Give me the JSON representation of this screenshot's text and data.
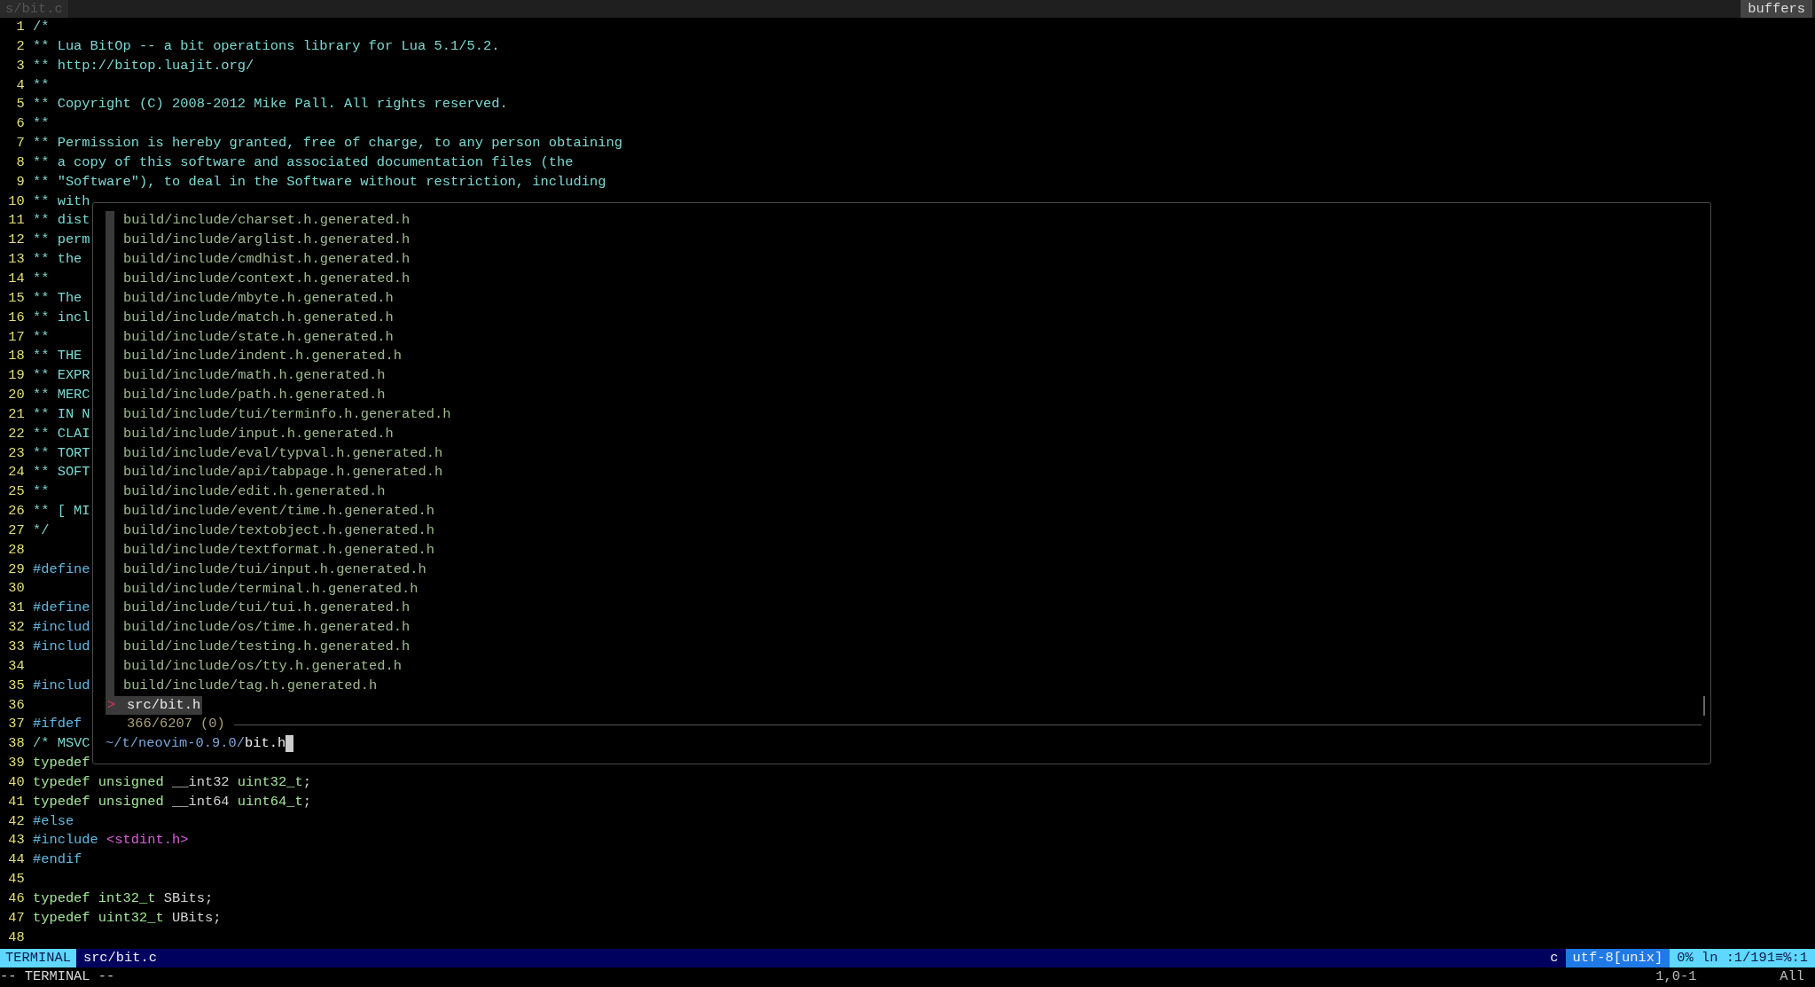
{
  "tabline": {
    "tab": "s/bit.c",
    "buffers_label": "buffers"
  },
  "editor": {
    "lines": [
      {
        "number": "1",
        "segments": [
          {
            "kind": "comment",
            "text": "/*"
          }
        ]
      },
      {
        "number": "2",
        "segments": [
          {
            "kind": "comment",
            "text": "** Lua BitOp -- a bit operations library for Lua 5.1/5.2."
          }
        ]
      },
      {
        "number": "3",
        "segments": [
          {
            "kind": "comment",
            "text": "** http://bitop.luajit.org/"
          }
        ]
      },
      {
        "number": "4",
        "segments": [
          {
            "kind": "comment",
            "text": "**"
          }
        ]
      },
      {
        "number": "5",
        "segments": [
          {
            "kind": "comment",
            "text": "** Copyright (C) 2008-2012 Mike Pall. All rights reserved."
          }
        ]
      },
      {
        "number": "6",
        "segments": [
          {
            "kind": "comment",
            "text": "**"
          }
        ]
      },
      {
        "number": "7",
        "segments": [
          {
            "kind": "comment",
            "text": "** Permission is hereby granted, free of charge, to any person obtaining"
          }
        ]
      },
      {
        "number": "8",
        "segments": [
          {
            "kind": "comment",
            "text": "** a copy of this software and associated documentation files (the"
          }
        ]
      },
      {
        "number": "9",
        "segments": [
          {
            "kind": "comment",
            "text": "** \"Software\"), to deal in the Software without restriction, including"
          }
        ]
      },
      {
        "number": "10",
        "segments": [
          {
            "kind": "comment",
            "text": "** with"
          }
        ]
      },
      {
        "number": "11",
        "segments": [
          {
            "kind": "comment",
            "text": "** dist"
          }
        ]
      },
      {
        "number": "12",
        "segments": [
          {
            "kind": "comment",
            "text": "** perm"
          }
        ]
      },
      {
        "number": "13",
        "segments": [
          {
            "kind": "comment",
            "text": "** the"
          }
        ]
      },
      {
        "number": "14",
        "segments": [
          {
            "kind": "comment",
            "text": "**"
          }
        ]
      },
      {
        "number": "15",
        "segments": [
          {
            "kind": "comment",
            "text": "** The"
          }
        ]
      },
      {
        "number": "16",
        "segments": [
          {
            "kind": "comment",
            "text": "** incl"
          }
        ]
      },
      {
        "number": "17",
        "segments": [
          {
            "kind": "comment",
            "text": "**"
          }
        ]
      },
      {
        "number": "18",
        "segments": [
          {
            "kind": "comment",
            "text": "** THE"
          }
        ]
      },
      {
        "number": "19",
        "segments": [
          {
            "kind": "comment",
            "text": "** EXPR"
          }
        ]
      },
      {
        "number": "20",
        "segments": [
          {
            "kind": "comment",
            "text": "** MERC"
          }
        ]
      },
      {
        "number": "21",
        "segments": [
          {
            "kind": "comment",
            "text": "** IN N"
          }
        ]
      },
      {
        "number": "22",
        "segments": [
          {
            "kind": "comment",
            "text": "** CLAI"
          }
        ]
      },
      {
        "number": "23",
        "segments": [
          {
            "kind": "comment",
            "text": "** TORT"
          }
        ]
      },
      {
        "number": "24",
        "segments": [
          {
            "kind": "comment",
            "text": "** SOFT"
          }
        ]
      },
      {
        "number": "25",
        "segments": [
          {
            "kind": "comment",
            "text": "**"
          }
        ]
      },
      {
        "number": "26",
        "segments": [
          {
            "kind": "comment",
            "text": "** [ MI"
          }
        ]
      },
      {
        "number": "27",
        "segments": [
          {
            "kind": "comment",
            "text": "*/"
          }
        ]
      },
      {
        "number": "28"
      },
      {
        "number": "29",
        "segments": [
          {
            "kind": "preproc",
            "text": "#define"
          }
        ]
      },
      {
        "number": "30"
      },
      {
        "number": "31",
        "segments": [
          {
            "kind": "preproc",
            "text": "#define"
          }
        ]
      },
      {
        "number": "32",
        "segments": [
          {
            "kind": "preproc",
            "text": "#includ"
          }
        ]
      },
      {
        "number": "33",
        "segments": [
          {
            "kind": "preproc",
            "text": "#includ"
          }
        ]
      },
      {
        "number": "34"
      },
      {
        "number": "35",
        "segments": [
          {
            "kind": "preproc",
            "text": "#includ"
          }
        ]
      },
      {
        "number": "36"
      },
      {
        "number": "37",
        "segments": [
          {
            "kind": "preproc",
            "text": "#ifdef"
          }
        ]
      },
      {
        "number": "38",
        "segments": [
          {
            "kind": "comment",
            "text": "/* MSVC"
          }
        ]
      },
      {
        "number": "39",
        "segments": [
          {
            "kind": "type",
            "text": "typedef"
          }
        ]
      },
      {
        "number": "40",
        "segments": [
          {
            "kind": "type",
            "text": "typedef unsigned"
          },
          {
            "kind": "plain",
            "text": " __int32 "
          },
          {
            "kind": "type",
            "text": "uint32_t"
          },
          {
            "kind": "plain",
            "text": ";"
          }
        ]
      },
      {
        "number": "41",
        "segments": [
          {
            "kind": "type",
            "text": "typedef unsigned"
          },
          {
            "kind": "plain",
            "text": " __int64 "
          },
          {
            "kind": "type",
            "text": "uint64_t"
          },
          {
            "kind": "plain",
            "text": ";"
          }
        ]
      },
      {
        "number": "42",
        "segments": [
          {
            "kind": "preproc",
            "text": "#else"
          }
        ]
      },
      {
        "number": "43",
        "segments": [
          {
            "kind": "preproc",
            "text": "#include"
          },
          {
            "kind": "string",
            "text": " <stdint.h>"
          }
        ]
      },
      {
        "number": "44",
        "segments": [
          {
            "kind": "preproc",
            "text": "#endif"
          }
        ]
      },
      {
        "number": "45"
      },
      {
        "number": "46",
        "segments": [
          {
            "kind": "type",
            "text": "typedef int32_t"
          },
          {
            "kind": "plain",
            "text": " SBits;"
          }
        ]
      },
      {
        "number": "47",
        "segments": [
          {
            "kind": "type",
            "text": "typedef uint32_t"
          },
          {
            "kind": "plain",
            "text": " UBits;"
          }
        ]
      },
      {
        "number": "48"
      }
    ]
  },
  "finder": {
    "items": [
      {
        "path": "build/include/charset.h.generated.h",
        "selected": false
      },
      {
        "path": "build/include/arglist.h.generated.h",
        "selected": false
      },
      {
        "path": "build/include/cmdhist.h.generated.h",
        "selected": false
      },
      {
        "path": "build/include/context.h.generated.h",
        "selected": false
      },
      {
        "path": "build/include/mbyte.h.generated.h",
        "selected": false
      },
      {
        "path": "build/include/match.h.generated.h",
        "selected": false
      },
      {
        "path": "build/include/state.h.generated.h",
        "selected": false
      },
      {
        "path": "build/include/indent.h.generated.h",
        "selected": false
      },
      {
        "path": "build/include/math.h.generated.h",
        "selected": false
      },
      {
        "path": "build/include/path.h.generated.h",
        "selected": false
      },
      {
        "path": "build/include/tui/terminfo.h.generated.h",
        "selected": false
      },
      {
        "path": "build/include/input.h.generated.h",
        "selected": false
      },
      {
        "path": "build/include/eval/typval.h.generated.h",
        "selected": false
      },
      {
        "path": "build/include/api/tabpage.h.generated.h",
        "selected": false
      },
      {
        "path": "build/include/edit.h.generated.h",
        "selected": false
      },
      {
        "path": "build/include/event/time.h.generated.h",
        "selected": false
      },
      {
        "path": "build/include/textobject.h.generated.h",
        "selected": false
      },
      {
        "path": "build/include/textformat.h.generated.h",
        "selected": false
      },
      {
        "path": "build/include/tui/input.h.generated.h",
        "selected": false
      },
      {
        "path": "build/include/terminal.h.generated.h",
        "selected": false
      },
      {
        "path": "build/include/tui/tui.h.generated.h",
        "selected": false
      },
      {
        "path": "build/include/os/time.h.generated.h",
        "selected": false
      },
      {
        "path": "build/include/testing.h.generated.h",
        "selected": false
      },
      {
        "path": "build/include/os/tty.h.generated.h",
        "selected": false
      },
      {
        "path": "build/include/tag.h.generated.h",
        "selected": false
      },
      {
        "path": "src/bit.h",
        "selected": true
      }
    ],
    "pointer": ">",
    "counter": "366/6207 (0)",
    "prompt": "~/t/neovim-0.9.0/",
    "query": "bit.h"
  },
  "status_bar": {
    "mode": "TERMINAL",
    "file": "src/bit.c",
    "filetype": "c",
    "encoding": "utf-8[unix]",
    "position": "0% ln :1/191≡%:1"
  },
  "command_line": {
    "message": "-- TERMINAL --",
    "cursor": "1,0-1",
    "scroll": "All"
  }
}
